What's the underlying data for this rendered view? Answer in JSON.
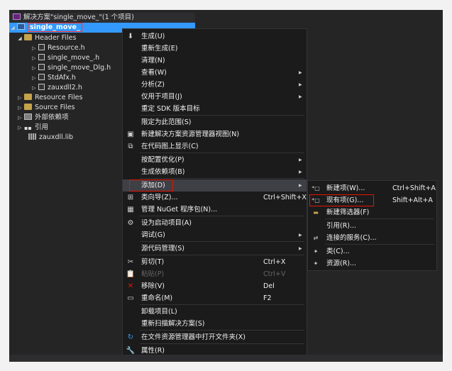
{
  "solution_explorer": {
    "solution_label": "解决方案\"single_move_\"(1 个项目)",
    "project_label": "single_move_",
    "header_files": "Header Files",
    "header_items": [
      "Resource.h",
      "single_move_.h",
      "single_move_Dlg.h",
      "StdAfx.h",
      "zauxdll2.h"
    ],
    "resource_files": "Resource Files",
    "source_files": "Source Files",
    "external_deps": "外部依赖项",
    "references": "引用",
    "lib_file": "zauxdll.lib"
  },
  "context_menu": {
    "items": [
      {
        "label": "生成(U)",
        "shortcut": "",
        "submenu": false,
        "disabled": false
      },
      {
        "label": "重新生成(E)",
        "shortcut": "",
        "submenu": false,
        "disabled": false
      },
      {
        "label": "清理(N)",
        "shortcut": "",
        "submenu": false,
        "disabled": false
      },
      {
        "label": "查看(W)",
        "shortcut": "",
        "submenu": true,
        "disabled": false
      },
      {
        "label": "分析(Z)",
        "shortcut": "",
        "submenu": true,
        "disabled": false
      },
      {
        "label": "仅用于项目(J)",
        "shortcut": "",
        "submenu": true,
        "disabled": false
      },
      {
        "label": "重定 SDK 版本目标",
        "shortcut": "",
        "submenu": false,
        "disabled": false
      },
      {
        "label": "限定为此范围(S)",
        "shortcut": "",
        "submenu": false,
        "disabled": false
      },
      {
        "label": "新建解决方案资源管理器视图(N)",
        "shortcut": "",
        "submenu": false,
        "disabled": false
      },
      {
        "label": "在代码图上显示(C)",
        "shortcut": "",
        "submenu": false,
        "disabled": false
      },
      {
        "label": "按配置优化(P)",
        "shortcut": "",
        "submenu": true,
        "disabled": false
      },
      {
        "label": "生成依赖项(B)",
        "shortcut": "",
        "submenu": true,
        "disabled": false
      },
      {
        "label": "添加(D)",
        "shortcut": "",
        "submenu": true,
        "disabled": false
      },
      {
        "label": "类向导(Z)...",
        "shortcut": "Ctrl+Shift+X",
        "submenu": false,
        "disabled": false
      },
      {
        "label": "管理 NuGet 程序包(N)...",
        "shortcut": "",
        "submenu": false,
        "disabled": false
      },
      {
        "label": "设为启动项目(A)",
        "shortcut": "",
        "submenu": false,
        "disabled": false
      },
      {
        "label": "调试(G)",
        "shortcut": "",
        "submenu": true,
        "disabled": false
      },
      {
        "label": "源代码管理(S)",
        "shortcut": "",
        "submenu": true,
        "disabled": false
      },
      {
        "label": "剪切(T)",
        "shortcut": "Ctrl+X",
        "submenu": false,
        "disabled": false
      },
      {
        "label": "粘贴(P)",
        "shortcut": "Ctrl+V",
        "submenu": false,
        "disabled": true
      },
      {
        "label": "移除(V)",
        "shortcut": "Del",
        "submenu": false,
        "disabled": false
      },
      {
        "label": "重命名(M)",
        "shortcut": "F2",
        "submenu": false,
        "disabled": false
      },
      {
        "label": "卸载项目(L)",
        "shortcut": "",
        "submenu": false,
        "disabled": false
      },
      {
        "label": "重新扫描解决方案(S)",
        "shortcut": "",
        "submenu": false,
        "disabled": false
      },
      {
        "label": "在文件资源管理器中打开文件夹(X)",
        "shortcut": "",
        "submenu": false,
        "disabled": false
      },
      {
        "label": "属性(R)",
        "shortcut": "",
        "submenu": false,
        "disabled": false
      }
    ]
  },
  "add_submenu": {
    "items": [
      {
        "label": "新建项(W)...",
        "shortcut": "Ctrl+Shift+A"
      },
      {
        "label": "现有项(G)...",
        "shortcut": "Shift+Alt+A"
      },
      {
        "label": "新建筛选器(F)",
        "shortcut": ""
      },
      {
        "label": "引用(R)...",
        "shortcut": ""
      },
      {
        "label": "连接的服务(C)...",
        "shortcut": ""
      },
      {
        "label": "类(C)...",
        "shortcut": ""
      },
      {
        "label": "资源(R)...",
        "shortcut": ""
      }
    ]
  },
  "icons": {
    "build": "build-icon",
    "new-view": "new-view-icon",
    "code-map": "code-map-icon",
    "class-wizard": "class-wizard-icon",
    "nuget": "nuget-icon",
    "gear": "gear-icon",
    "cut": "cut-icon",
    "paste": "paste-icon",
    "remove": "remove-icon",
    "rename": "rename-icon",
    "refresh": "refresh-icon",
    "wrench": "wrench-icon"
  },
  "colors": {
    "background": "#252526",
    "menu_bg": "#1b1b1c",
    "highlight": "#3f3f46",
    "selection": "#3399ff",
    "red_outline": "#e51400"
  }
}
